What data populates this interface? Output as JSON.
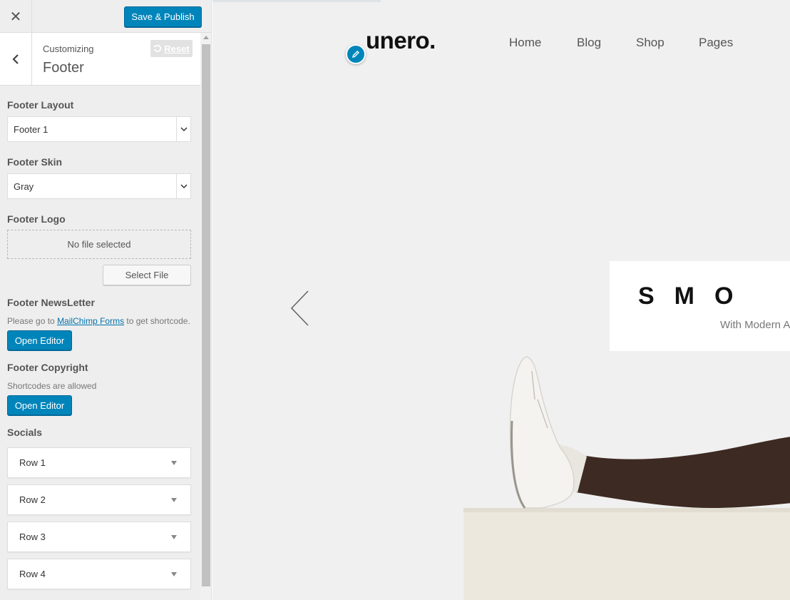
{
  "toolbar": {
    "close_icon": "close-icon",
    "save_label": "Save & Publish"
  },
  "section": {
    "customizing_label": "Customizing",
    "title": "Footer",
    "reset_label": "Reset"
  },
  "controls": {
    "footer_layout": {
      "label": "Footer Layout",
      "value": "Footer 1"
    },
    "footer_skin": {
      "label": "Footer Skin",
      "value": "Gray"
    },
    "footer_logo": {
      "label": "Footer Logo",
      "no_file": "No file selected",
      "select_label": "Select File"
    },
    "newsletter": {
      "label": "Footer NewsLetter",
      "desc_before": "Please go to ",
      "desc_link": "MailChimp Forms",
      "desc_after": " to get shortcode.",
      "button": "Open Editor"
    },
    "copyright": {
      "label": "Footer Copyright",
      "desc": "Shortcodes are allowed",
      "button": "Open Editor"
    },
    "socials": {
      "label": "Socials",
      "rows": [
        "Row 1",
        "Row 2",
        "Row 3",
        "Row 4"
      ]
    }
  },
  "preview": {
    "logo": "unero.",
    "nav": [
      "Home",
      "Blog",
      "Shop",
      "Pages"
    ],
    "slide_title": "SMO",
    "slide_subtitle": "With Modern A"
  },
  "colors": {
    "accent": "#0085ba",
    "sidebar_bg": "#eeeeee",
    "preview_bg": "#f0f0f0"
  }
}
